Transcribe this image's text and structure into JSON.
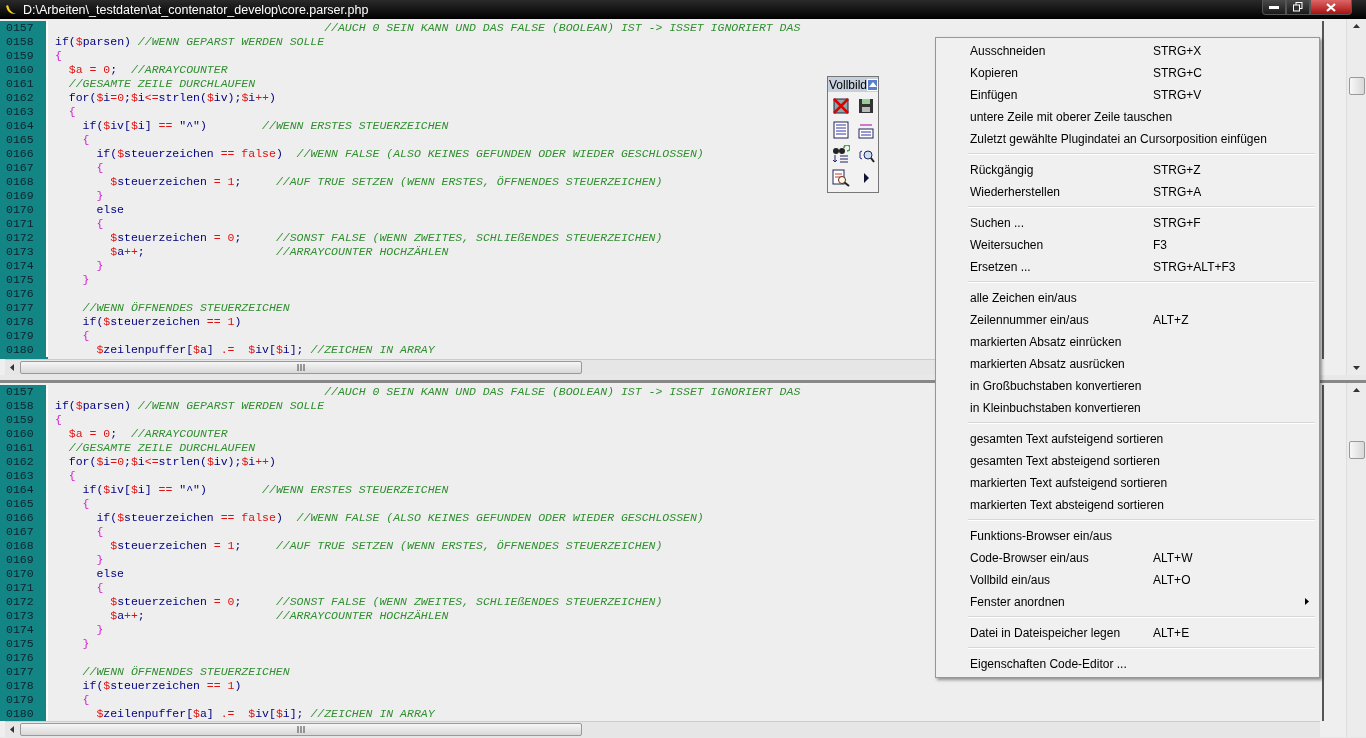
{
  "window": {
    "title": "D:\\Arbeiten\\_testdaten\\at_contenator_develop\\core.parser.php"
  },
  "panes": [
    {
      "lines": [
        {
          "number": "0157",
          "tokens": [
            {
              "kind": "comment",
              "text": "                                       //AUCH 0 SEIN KANN UND DAS FALSE (BOOLEAN) IST -> ISSET IGNORIERT DAS"
            }
          ]
        },
        {
          "number": "0158",
          "tokens": [
            {
              "kind": "code",
              "text": "if("
            },
            {
              "kind": "sigil",
              "text": "$"
            },
            {
              "kind": "code",
              "text": "parsen) "
            },
            {
              "kind": "comment",
              "text": "//WENN GEPARST WERDEN SOLLE"
            }
          ]
        },
        {
          "number": "0159",
          "tokens": [
            {
              "kind": "brace",
              "text": "{"
            }
          ]
        },
        {
          "number": "0160",
          "tokens": [
            {
              "kind": "sigil",
              "text": "  $a = 0"
            },
            {
              "kind": "code",
              "text": ";  "
            },
            {
              "kind": "comment",
              "text": "//ARRAYCOUNTER"
            }
          ]
        },
        {
          "number": "0161",
          "tokens": [
            {
              "kind": "comment",
              "text": "  //GESAMTE ZEILE DURCHLAUFEN"
            }
          ]
        },
        {
          "number": "0162",
          "tokens": [
            {
              "kind": "code",
              "text": "  for("
            },
            {
              "kind": "sigil",
              "text": "$"
            },
            {
              "kind": "code",
              "text": "i"
            },
            {
              "kind": "sigil",
              "text": "=0"
            },
            {
              "kind": "code",
              "text": ";"
            },
            {
              "kind": "sigil",
              "text": "$"
            },
            {
              "kind": "code",
              "text": "i"
            },
            {
              "kind": "sigil",
              "text": "<="
            },
            {
              "kind": "code",
              "text": "strlen("
            },
            {
              "kind": "sigil",
              "text": "$"
            },
            {
              "kind": "code",
              "text": "iv);"
            },
            {
              "kind": "sigil",
              "text": "$"
            },
            {
              "kind": "code",
              "text": "i"
            },
            {
              "kind": "sigil",
              "text": "++"
            },
            {
              "kind": "code",
              "text": ")"
            }
          ]
        },
        {
          "number": "0163",
          "tokens": [
            {
              "kind": "brace",
              "text": "  {"
            }
          ]
        },
        {
          "number": "0164",
          "tokens": [
            {
              "kind": "code",
              "text": "    if("
            },
            {
              "kind": "sigil",
              "text": "$"
            },
            {
              "kind": "code",
              "text": "iv["
            },
            {
              "kind": "sigil",
              "text": "$"
            },
            {
              "kind": "code",
              "text": "i] "
            },
            {
              "kind": "sigil",
              "text": "=="
            },
            {
              "kind": "code",
              "text": " \"^\")        "
            },
            {
              "kind": "comment",
              "text": "//WENN ERSTES STEUERZEICHEN"
            }
          ]
        },
        {
          "number": "0165",
          "tokens": [
            {
              "kind": "brace",
              "text": "    {"
            }
          ]
        },
        {
          "number": "0166",
          "tokens": [
            {
              "kind": "code",
              "text": "      if("
            },
            {
              "kind": "sigil",
              "text": "$"
            },
            {
              "kind": "code",
              "text": "steuerzeichen "
            },
            {
              "kind": "sigil",
              "text": "== false"
            },
            {
              "kind": "code",
              "text": ")  "
            },
            {
              "kind": "comment",
              "text": "//WENN FALSE (ALSO KEINES GEFUNDEN ODER WIEDER GESCHLOSSEN)"
            }
          ]
        },
        {
          "number": "0167",
          "tokens": [
            {
              "kind": "brace",
              "text": "      {"
            }
          ]
        },
        {
          "number": "0168",
          "tokens": [
            {
              "kind": "sigil",
              "text": "        $"
            },
            {
              "kind": "code",
              "text": "steuerzeichen "
            },
            {
              "kind": "sigil",
              "text": "= 1"
            },
            {
              "kind": "code",
              "text": ";     "
            },
            {
              "kind": "comment",
              "text": "//AUF TRUE SETZEN (WENN ERSTES, ÖFFNENDES STEUERZEICHEN)"
            }
          ]
        },
        {
          "number": "0169",
          "tokens": [
            {
              "kind": "brace",
              "text": "      }"
            }
          ]
        },
        {
          "number": "0170",
          "tokens": [
            {
              "kind": "code",
              "text": "      else"
            }
          ]
        },
        {
          "number": "0171",
          "tokens": [
            {
              "kind": "brace",
              "text": "      {"
            }
          ]
        },
        {
          "number": "0172",
          "tokens": [
            {
              "kind": "sigil",
              "text": "        $"
            },
            {
              "kind": "code",
              "text": "steuerzeichen "
            },
            {
              "kind": "sigil",
              "text": "= 0"
            },
            {
              "kind": "code",
              "text": ";     "
            },
            {
              "kind": "comment",
              "text": "//SONST FALSE (WENN ZWEITES, SCHLIEßENDES STEUERZEICHEN)"
            }
          ]
        },
        {
          "number": "0173",
          "tokens": [
            {
              "kind": "sigil",
              "text": "        $"
            },
            {
              "kind": "code",
              "text": "a"
            },
            {
              "kind": "sigil",
              "text": "++"
            },
            {
              "kind": "code",
              "text": ";                   "
            },
            {
              "kind": "comment",
              "text": "//ARRAYCOUNTER HOCHZÄHLEN"
            }
          ]
        },
        {
          "number": "0174",
          "tokens": [
            {
              "kind": "brace",
              "text": "      }"
            }
          ]
        },
        {
          "number": "0175",
          "tokens": [
            {
              "kind": "brace",
              "text": "    }"
            }
          ]
        },
        {
          "number": "0176"
        },
        {
          "number": "0177",
          "tokens": [
            {
              "kind": "comment",
              "text": "    //WENN ÖFFNENDES STEUERZEICHEN"
            }
          ]
        },
        {
          "number": "0178",
          "tokens": [
            {
              "kind": "code",
              "text": "    if("
            },
            {
              "kind": "sigil",
              "text": "$"
            },
            {
              "kind": "code",
              "text": "steuerzeichen "
            },
            {
              "kind": "sigil",
              "text": "== 1"
            },
            {
              "kind": "code",
              "text": ")"
            }
          ]
        },
        {
          "number": "0179",
          "tokens": [
            {
              "kind": "brace",
              "text": "    {"
            }
          ]
        },
        {
          "number": "0180",
          "tokens": [
            {
              "kind": "sigil",
              "text": "      $"
            },
            {
              "kind": "code",
              "text": "zeilenpuffer["
            },
            {
              "kind": "sigil",
              "text": "$"
            },
            {
              "kind": "code",
              "text": "a] "
            },
            {
              "kind": "sigil",
              "text": ".=  $"
            },
            {
              "kind": "code",
              "text": "iv["
            },
            {
              "kind": "sigil",
              "text": "$"
            },
            {
              "kind": "code",
              "text": "i]; "
            },
            {
              "kind": "comment",
              "text": "//ZEICHEN IN ARRAY"
            }
          ]
        }
      ]
    },
    {
      "lines": [
        {
          "number": "0157",
          "tokens": [
            {
              "kind": "comment",
              "text": "                                       //AUCH 0 SEIN KANN UND DAS FALSE (BOOLEAN) IST -> ISSET IGNORIERT DAS"
            }
          ]
        },
        {
          "number": "0158",
          "tokens": [
            {
              "kind": "code",
              "text": "if("
            },
            {
              "kind": "sigil",
              "text": "$"
            },
            {
              "kind": "code",
              "text": "parsen) "
            },
            {
              "kind": "comment",
              "text": "//WENN GEPARST WERDEN SOLLE"
            }
          ]
        },
        {
          "number": "0159",
          "tokens": [
            {
              "kind": "brace",
              "text": "{"
            }
          ]
        },
        {
          "number": "0160",
          "tokens": [
            {
              "kind": "sigil",
              "text": "  $a = 0"
            },
            {
              "kind": "code",
              "text": ";  "
            },
            {
              "kind": "comment",
              "text": "//ARRAYCOUNTER"
            }
          ]
        },
        {
          "number": "0161",
          "tokens": [
            {
              "kind": "comment",
              "text": "  //GESAMTE ZEILE DURCHLAUFEN"
            }
          ]
        },
        {
          "number": "0162",
          "tokens": [
            {
              "kind": "code",
              "text": "  for("
            },
            {
              "kind": "sigil",
              "text": "$"
            },
            {
              "kind": "code",
              "text": "i"
            },
            {
              "kind": "sigil",
              "text": "=0"
            },
            {
              "kind": "code",
              "text": ";"
            },
            {
              "kind": "sigil",
              "text": "$"
            },
            {
              "kind": "code",
              "text": "i"
            },
            {
              "kind": "sigil",
              "text": "<="
            },
            {
              "kind": "code",
              "text": "strlen("
            },
            {
              "kind": "sigil",
              "text": "$"
            },
            {
              "kind": "code",
              "text": "iv);"
            },
            {
              "kind": "sigil",
              "text": "$"
            },
            {
              "kind": "code",
              "text": "i"
            },
            {
              "kind": "sigil",
              "text": "++"
            },
            {
              "kind": "code",
              "text": ")"
            }
          ]
        },
        {
          "number": "0163",
          "tokens": [
            {
              "kind": "brace",
              "text": "  {"
            }
          ]
        },
        {
          "number": "0164",
          "tokens": [
            {
              "kind": "code",
              "text": "    if("
            },
            {
              "kind": "sigil",
              "text": "$"
            },
            {
              "kind": "code",
              "text": "iv["
            },
            {
              "kind": "sigil",
              "text": "$"
            },
            {
              "kind": "code",
              "text": "i] "
            },
            {
              "kind": "sigil",
              "text": "=="
            },
            {
              "kind": "code",
              "text": " \"^\")        "
            },
            {
              "kind": "comment",
              "text": "//WENN ERSTES STEUERZEICHEN"
            }
          ]
        },
        {
          "number": "0165",
          "tokens": [
            {
              "kind": "brace",
              "text": "    {"
            }
          ]
        },
        {
          "number": "0166",
          "tokens": [
            {
              "kind": "code",
              "text": "      if("
            },
            {
              "kind": "sigil",
              "text": "$"
            },
            {
              "kind": "code",
              "text": "steuerzeichen "
            },
            {
              "kind": "sigil",
              "text": "== false"
            },
            {
              "kind": "code",
              "text": ")  "
            },
            {
              "kind": "comment",
              "text": "//WENN FALSE (ALSO KEINES GEFUNDEN ODER WIEDER GESCHLOSSEN)"
            }
          ]
        },
        {
          "number": "0167",
          "tokens": [
            {
              "kind": "brace",
              "text": "      {"
            }
          ]
        },
        {
          "number": "0168",
          "tokens": [
            {
              "kind": "sigil",
              "text": "        $"
            },
            {
              "kind": "code",
              "text": "steuerzeichen "
            },
            {
              "kind": "sigil",
              "text": "= 1"
            },
            {
              "kind": "code",
              "text": ";     "
            },
            {
              "kind": "comment",
              "text": "//AUF TRUE SETZEN (WENN ERSTES, ÖFFNENDES STEUERZEICHEN)"
            }
          ]
        },
        {
          "number": "0169",
          "tokens": [
            {
              "kind": "brace",
              "text": "      }"
            }
          ]
        },
        {
          "number": "0170",
          "tokens": [
            {
              "kind": "code",
              "text": "      else"
            }
          ]
        },
        {
          "number": "0171",
          "tokens": [
            {
              "kind": "brace",
              "text": "      {"
            }
          ]
        },
        {
          "number": "0172",
          "tokens": [
            {
              "kind": "sigil",
              "text": "        $"
            },
            {
              "kind": "code",
              "text": "steuerzeichen "
            },
            {
              "kind": "sigil",
              "text": "= 0"
            },
            {
              "kind": "code",
              "text": ";     "
            },
            {
              "kind": "comment",
              "text": "//SONST FALSE (WENN ZWEITES, SCHLIEßENDES STEUERZEICHEN)"
            }
          ]
        },
        {
          "number": "0173",
          "tokens": [
            {
              "kind": "sigil",
              "text": "        $"
            },
            {
              "kind": "code",
              "text": "a"
            },
            {
              "kind": "sigil",
              "text": "++"
            },
            {
              "kind": "code",
              "text": ";                   "
            },
            {
              "kind": "comment",
              "text": "//ARRAYCOUNTER HOCHZÄHLEN"
            }
          ]
        },
        {
          "number": "0174",
          "tokens": [
            {
              "kind": "brace",
              "text": "      }"
            }
          ]
        },
        {
          "number": "0175",
          "tokens": [
            {
              "kind": "brace",
              "text": "    }"
            }
          ]
        },
        {
          "number": "0176"
        },
        {
          "number": "0177",
          "tokens": [
            {
              "kind": "comment",
              "text": "    //WENN ÖFFNENDES STEUERZEICHEN"
            }
          ]
        },
        {
          "number": "0178",
          "tokens": [
            {
              "kind": "code",
              "text": "    if("
            },
            {
              "kind": "sigil",
              "text": "$"
            },
            {
              "kind": "code",
              "text": "steuerzeichen "
            },
            {
              "kind": "sigil",
              "text": "== 1"
            },
            {
              "kind": "code",
              "text": ")"
            }
          ]
        },
        {
          "number": "0179",
          "tokens": [
            {
              "kind": "brace",
              "text": "    {"
            }
          ]
        },
        {
          "number": "0180",
          "tokens": [
            {
              "kind": "sigil",
              "text": "      $"
            },
            {
              "kind": "code",
              "text": "zeilenpuffer["
            },
            {
              "kind": "sigil",
              "text": "$"
            },
            {
              "kind": "code",
              "text": "a] "
            },
            {
              "kind": "sigil",
              "text": ".=  $"
            },
            {
              "kind": "code",
              "text": "iv["
            },
            {
              "kind": "sigil",
              "text": "$"
            },
            {
              "kind": "code",
              "text": "i]; "
            },
            {
              "kind": "comment",
              "text": "//ZEICHEN IN ARRAY"
            }
          ]
        }
      ]
    }
  ],
  "floating_toolbar": {
    "title": "Vollbild"
  },
  "context_menu": {
    "groups": [
      [
        {
          "label": "Ausschneiden",
          "shortcut": "STRG+X",
          "submenu": false
        },
        {
          "label": "Kopieren",
          "shortcut": "STRG+C",
          "submenu": false
        },
        {
          "label": "Einfügen",
          "shortcut": "STRG+V",
          "submenu": false
        },
        {
          "label": "untere Zeile mit oberer Zeile tauschen",
          "submenu": false
        },
        {
          "label": "Zuletzt gewählte Plugindatei an Cursorposition einfügen",
          "submenu": false
        }
      ],
      [
        {
          "label": "Rückgängig",
          "shortcut": "STRG+Z",
          "submenu": false
        },
        {
          "label": "Wiederherstellen",
          "shortcut": "STRG+A",
          "submenu": false
        }
      ],
      [
        {
          "label": "Suchen ...",
          "shortcut": "STRG+F",
          "submenu": false
        },
        {
          "label": "Weitersuchen",
          "shortcut": "F3",
          "submenu": false
        },
        {
          "label": "Ersetzen ...",
          "shortcut": "STRG+ALT+F3",
          "submenu": false
        }
      ],
      [
        {
          "label": "alle Zeichen ein/aus",
          "submenu": false
        },
        {
          "label": "Zeilennummer ein/aus",
          "shortcut": "ALT+Z",
          "submenu": false
        },
        {
          "label": "markierten Absatz einrücken",
          "submenu": false
        },
        {
          "label": "markierten Absatz ausrücken",
          "submenu": false
        },
        {
          "label": "in Großbuchstaben konvertieren",
          "submenu": false
        },
        {
          "label": "in Kleinbuchstaben konvertieren",
          "submenu": false
        }
      ],
      [
        {
          "label": "gesamten Text aufsteigend sortieren",
          "submenu": false
        },
        {
          "label": "gesamten Text absteigend sortieren",
          "submenu": false
        },
        {
          "label": "markierten Text aufsteigend sortieren",
          "submenu": false
        },
        {
          "label": "markierten Text absteigend sortieren",
          "submenu": false
        }
      ],
      [
        {
          "label": "Funktions-Browser ein/aus",
          "submenu": false
        },
        {
          "label": "Code-Browser ein/aus",
          "shortcut": "ALT+W",
          "submenu": false
        },
        {
          "label": "Vollbild ein/aus",
          "shortcut": "ALT+O",
          "submenu": false
        },
        {
          "label": "Fenster anordnen",
          "submenu": true
        }
      ],
      [
        {
          "label": "Datei in Dateispeicher legen",
          "shortcut": "ALT+E",
          "submenu": false
        }
      ],
      [
        {
          "label": "Eigenschaften Code-Editor ...",
          "submenu": false
        }
      ]
    ]
  }
}
